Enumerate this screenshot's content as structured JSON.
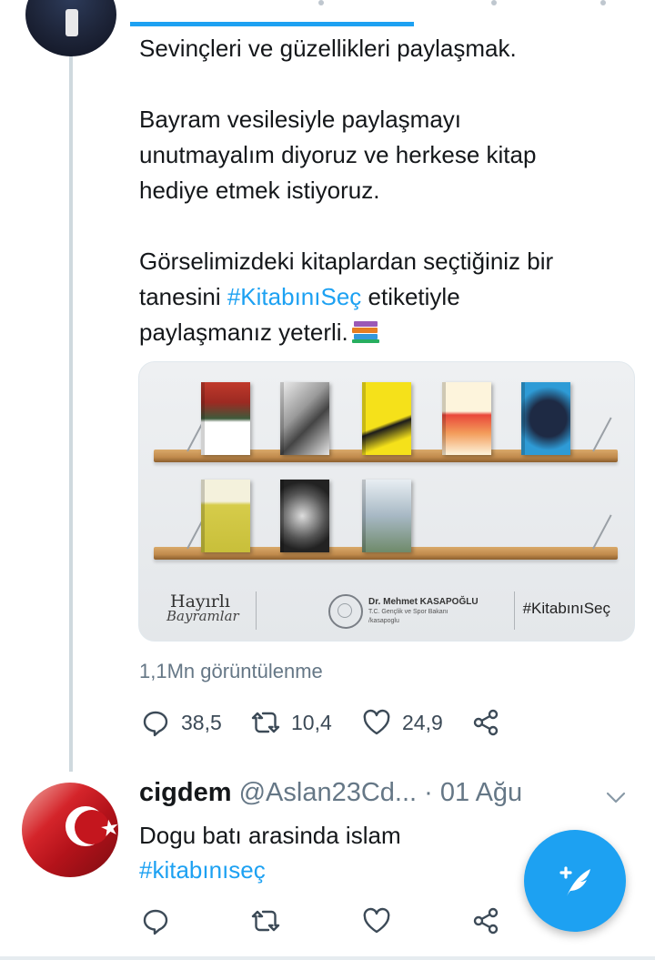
{
  "tweet": {
    "text_line1": "Sevinçleri ve güzellikleri paylaşmak.",
    "text_para2": "Bayram vesilesiyle paylaşmayı\nunutmayalım diyoruz ve herkese kitap\nhediye etmek istiyoruz.",
    "text_para3_start": "Görselimizdeki kitaplardan seçtiğiniz bir\ntanesini ",
    "hashtag": "#KitabınıSeç",
    "text_para3_mid": " etiketiyle\npaylaşmanız yeterli.",
    "emoji": "books-emoji",
    "views": "1,1Mn görüntülenme",
    "reply_count": "38,5",
    "retweet_count": "10,4",
    "like_count": "24,9"
  },
  "media": {
    "greeting_line1": "Hayırlı",
    "greeting_line2": "Bayramlar",
    "minister_name": "Dr. Mehmet KASAPOĞLU",
    "minister_title": "T.C. Gençlik ve Spor Bakanı",
    "minister_social": "/kasapoglu",
    "hashtag": "#KitabınıSeç",
    "books_top": [
      "book-1",
      "book-2",
      "book-3",
      "book-4",
      "book-5"
    ],
    "books_bottom": [
      "book-6",
      "book-7",
      "book-8"
    ]
  },
  "reply": {
    "name": "cigdem",
    "handle": "@Aslan23Cd...",
    "separator": " · ",
    "date": "01 Ağu",
    "text": "Dogu batı arasinda islam",
    "hashtag": "#kitabınıseç"
  },
  "colors": {
    "accent": "#1da1f2",
    "text": "#14171a",
    "muted": "#657786"
  },
  "icons": {
    "reply": "reply-icon",
    "retweet": "retweet-icon",
    "like": "heart-icon",
    "share": "share-icon",
    "compose": "compose-tweet-icon",
    "chevron": "chevron-down-icon"
  }
}
